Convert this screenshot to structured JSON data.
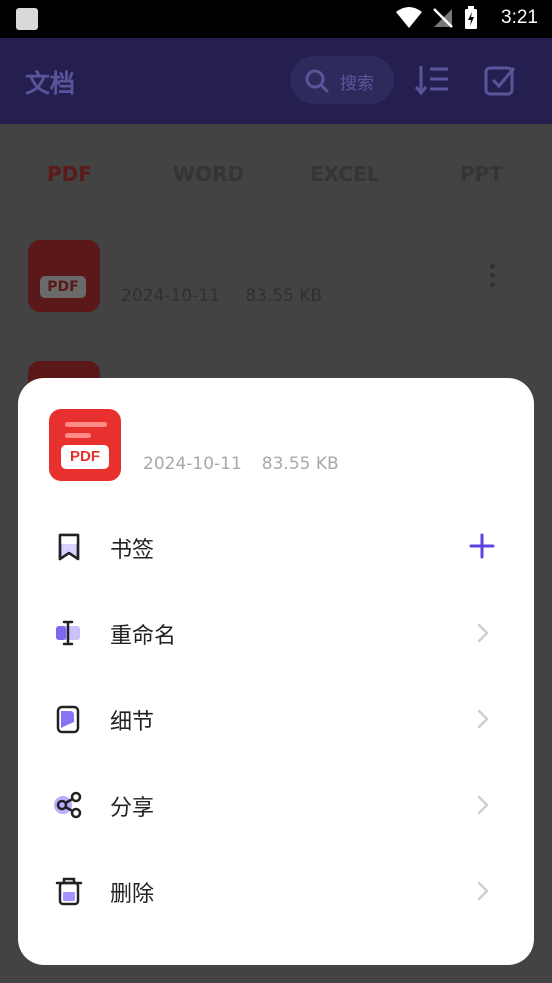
{
  "status_bar": {
    "time": "3:21"
  },
  "app_bar": {
    "title": "文档",
    "search_placeholder": "搜索"
  },
  "tabs": [
    "PDF",
    "WORD",
    "EXCEL",
    "PPT"
  ],
  "file_list": [
    {
      "date": "2024-10-11",
      "size": "83.55 KB"
    }
  ],
  "sheet": {
    "file_date": "2024-10-11",
    "file_size": "83.55 KB",
    "thumb_badge": "PDF",
    "menu": [
      {
        "label": "书签",
        "icon": "bookmark-icon",
        "trailing": "plus"
      },
      {
        "label": "重命名",
        "icon": "rename-icon",
        "trailing": "chevron"
      },
      {
        "label": "细节",
        "icon": "details-icon",
        "trailing": "chevron"
      },
      {
        "label": "分享",
        "icon": "share-icon",
        "trailing": "chevron"
      },
      {
        "label": "删除",
        "icon": "delete-icon",
        "trailing": "chevron"
      }
    ]
  },
  "colors": {
    "accent": "#5b45e0",
    "pdf_red": "#e8302e",
    "overlay": "#434343"
  }
}
